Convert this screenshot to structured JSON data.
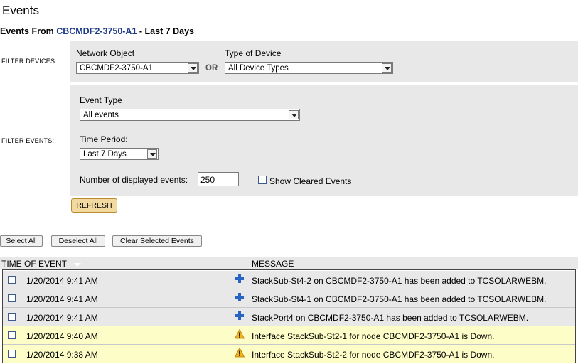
{
  "page": {
    "title": "Events"
  },
  "header": {
    "prefix": "Events From ",
    "device": "CBCMDF2-3750-A1",
    "suffix": " - Last 7 Days"
  },
  "filter_devices": {
    "label": "FILTER DEVICES:",
    "network_object_label": "Network Object",
    "network_object_value": "CBCMDF2-3750-A1",
    "or_label": "OR",
    "device_type_label": "Type of Device",
    "device_type_value": "All Device Types"
  },
  "filter_events": {
    "label": "FILTER EVENTS:",
    "event_type_label": "Event Type",
    "event_type_value": "All events",
    "time_period_label": "Time Period:",
    "time_period_value": "Last 7 Days",
    "count_label": "Number of displayed events:",
    "count_value": "250",
    "show_cleared_label": "Show Cleared Events"
  },
  "buttons": {
    "refresh": "REFRESH",
    "select_all": "Select All",
    "deselect_all": "Deselect All",
    "clear_selected": "Clear Selected Events"
  },
  "table": {
    "col_time": "TIME OF EVENT",
    "col_message": "MESSAGE",
    "rows": [
      {
        "time": "1/20/2014 9:41 AM",
        "icon": "plus-icon",
        "message": "StackSub-St4-2 on CBCMDF2-3750-A1 has been added to TCSOLARWEBM.",
        "bg": "#e8e8e8"
      },
      {
        "time": "1/20/2014 9:41 AM",
        "icon": "plus-icon",
        "message": "StackSub-St4-1 on CBCMDF2-3750-A1 has been added to TCSOLARWEBM.",
        "bg": "#e8e8e8"
      },
      {
        "time": "1/20/2014 9:41 AM",
        "icon": "plus-icon",
        "message": "StackPort4 on CBCMDF2-3750-A1 has been added to TCSOLARWEBM.",
        "bg": "#e8e8e8"
      },
      {
        "time": "1/20/2014 9:40 AM",
        "icon": "warning-icon",
        "message": "Interface StackSub-St2-1 for node CBCMDF2-3750-A1 is Down.",
        "bg": "#fdfdc8"
      },
      {
        "time": "1/20/2014 9:38 AM",
        "icon": "warning-icon",
        "message": "Interface StackSub-St2-2 for node CBCMDF2-3750-A1 is Down.",
        "bg": "#fdfdc8"
      }
    ]
  }
}
